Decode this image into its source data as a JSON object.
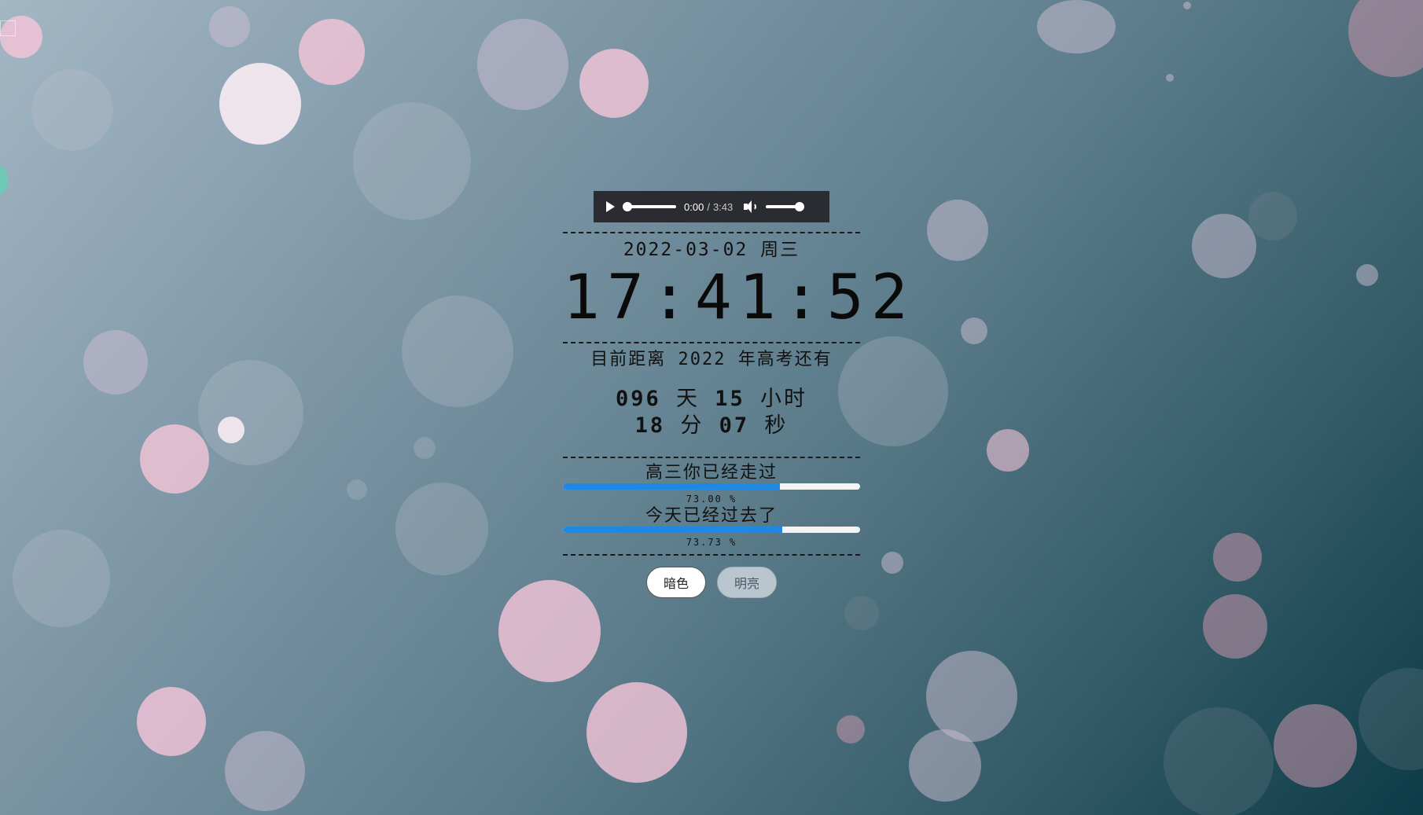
{
  "colors": {
    "progress_fill": "#1e88e5",
    "progress_track": "#f4f4f4",
    "audio_bg": "#2a2c31",
    "text": "#111111",
    "edge_handle": "#6fc9b6"
  },
  "audio_player": {
    "play_icon": "play-icon",
    "current_time": "0:00",
    "separator": "/",
    "duration": "3:43",
    "volume_icon": "volume-icon",
    "seek_progress": 0,
    "volume_level": 1.0
  },
  "date": "2022-03-02 周三",
  "clock": "17:41:52",
  "exam": {
    "label": "目前距离 2022 年高考还有"
  },
  "countdown": {
    "days": "096",
    "days_unit": "天",
    "hours": "15",
    "hours_unit": "小时",
    "minutes": "18",
    "minutes_unit": "分",
    "seconds": "07",
    "seconds_unit": "秒"
  },
  "progress": [
    {
      "label": "高三你已经走过",
      "percent_text": "73.00 %",
      "value": 0.73
    },
    {
      "label": "今天已经过去了",
      "percent_text": "73.73 %",
      "value": 0.7373
    }
  ],
  "theme_buttons": {
    "dark": "暗色",
    "light": "明亮"
  }
}
